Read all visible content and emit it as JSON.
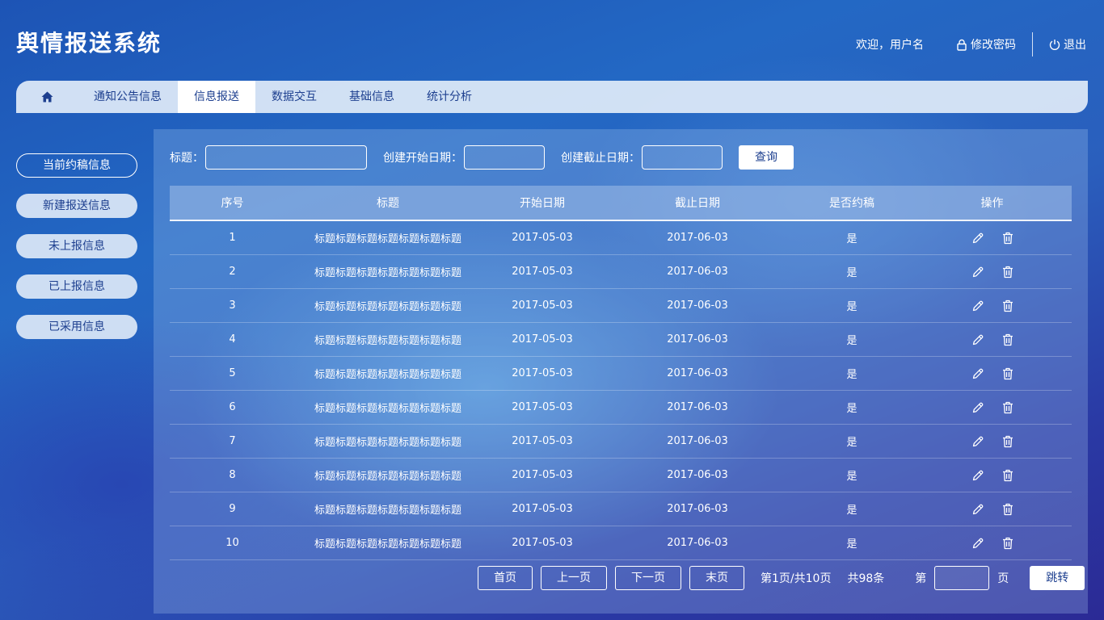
{
  "app": {
    "title": "舆情报送系统"
  },
  "header": {
    "welcome": "欢迎，用户名",
    "change_password": "修改密码",
    "logout": "退出"
  },
  "nav": {
    "tabs": [
      {
        "label": "通知公告信息",
        "active": false
      },
      {
        "label": "信息报送",
        "active": true
      },
      {
        "label": "数据交互",
        "active": false
      },
      {
        "label": "基础信息",
        "active": false
      },
      {
        "label": "统计分析",
        "active": false
      }
    ]
  },
  "sidebar": {
    "items": [
      {
        "label": "当前约稿信息",
        "active": true
      },
      {
        "label": "新建报送信息",
        "active": false
      },
      {
        "label": "未上报信息",
        "active": false
      },
      {
        "label": "已上报信息",
        "active": false
      },
      {
        "label": "已采用信息",
        "active": false
      }
    ]
  },
  "search": {
    "title_label": "标题：",
    "title_value": "",
    "start_label": "创建开始日期：",
    "start_value": "",
    "end_label": "创建截止日期：",
    "end_value": "",
    "query_button": "查询"
  },
  "table": {
    "headers": [
      "序号",
      "标题",
      "开始日期",
      "截止日期",
      "是否约稿",
      "操作"
    ],
    "rows": [
      {
        "no": "1",
        "title": "标题标题标题标题标题标题标题",
        "start": "2017-05-03",
        "end": "2017-06-03",
        "invited": "是"
      },
      {
        "no": "2",
        "title": "标题标题标题标题标题标题标题",
        "start": "2017-05-03",
        "end": "2017-06-03",
        "invited": "是"
      },
      {
        "no": "3",
        "title": "标题标题标题标题标题标题标题",
        "start": "2017-05-03",
        "end": "2017-06-03",
        "invited": "是"
      },
      {
        "no": "4",
        "title": "标题标题标题标题标题标题标题",
        "start": "2017-05-03",
        "end": "2017-06-03",
        "invited": "是"
      },
      {
        "no": "5",
        "title": "标题标题标题标题标题标题标题",
        "start": "2017-05-03",
        "end": "2017-06-03",
        "invited": "是"
      },
      {
        "no": "6",
        "title": "标题标题标题标题标题标题标题",
        "start": "2017-05-03",
        "end": "2017-06-03",
        "invited": "是"
      },
      {
        "no": "7",
        "title": "标题标题标题标题标题标题标题",
        "start": "2017-05-03",
        "end": "2017-06-03",
        "invited": "是"
      },
      {
        "no": "8",
        "title": "标题标题标题标题标题标题标题",
        "start": "2017-05-03",
        "end": "2017-06-03",
        "invited": "是"
      },
      {
        "no": "9",
        "title": "标题标题标题标题标题标题标题",
        "start": "2017-05-03",
        "end": "2017-06-03",
        "invited": "是"
      },
      {
        "no": "10",
        "title": "标题标题标题标题标题标题标题",
        "start": "2017-05-03",
        "end": "2017-06-03",
        "invited": "是"
      }
    ]
  },
  "pagination": {
    "first": "首页",
    "prev": "上一页",
    "next": "下一页",
    "last": "末页",
    "page_info": "第1页/共10页",
    "total": "共98条",
    "goto_prefix": "第",
    "goto_value": "",
    "goto_suffix": "页",
    "goto_button": "跳转"
  },
  "icons": {
    "home": "home-icon",
    "lock": "lock-icon",
    "power": "power-icon",
    "edit": "pencil-icon",
    "delete": "trash-icon"
  },
  "colors": {
    "accent": "#1d3f8f",
    "nav_bg": "#e1ebf8"
  }
}
